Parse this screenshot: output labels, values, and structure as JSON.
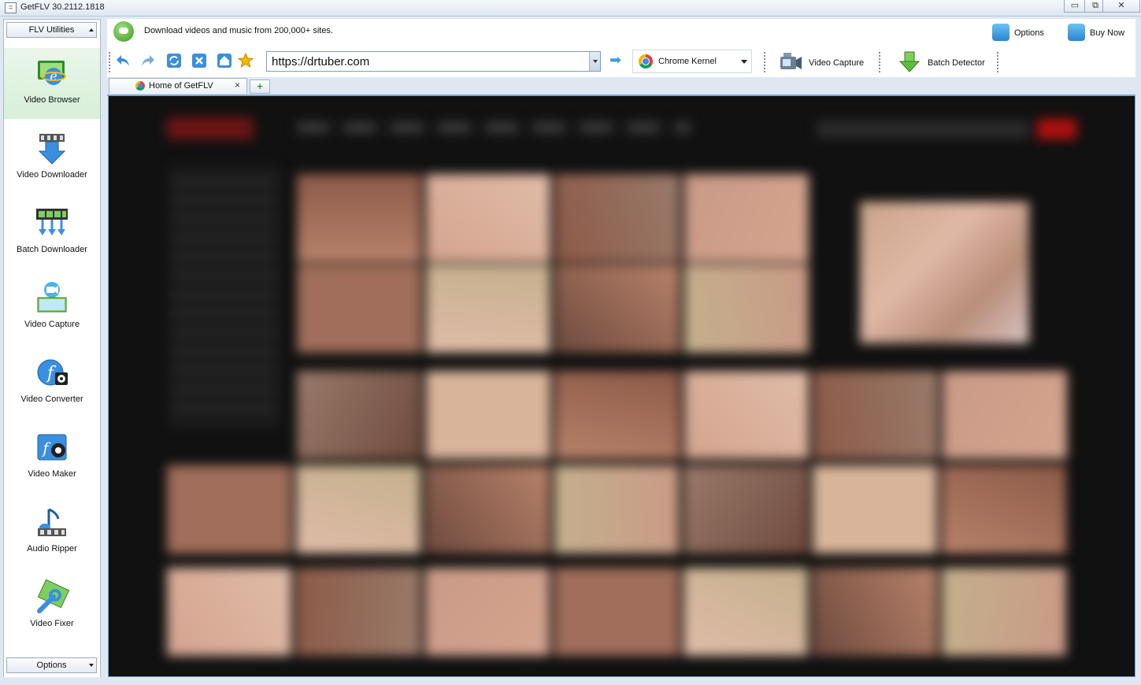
{
  "window": {
    "title": "GetFLV 30.2112.1818",
    "sys_menu": "=",
    "minimize": "▭",
    "maximize": "⧉",
    "close": "✕"
  },
  "sidebar": {
    "top_dropdown": "FLV Utilities",
    "bottom_dropdown": "Options",
    "items": [
      {
        "label": "Video Browser",
        "icon": "video-browser-icon",
        "active": true
      },
      {
        "label": "Video Downloader",
        "icon": "video-downloader-icon"
      },
      {
        "label": "Batch Downloader",
        "icon": "batch-downloader-icon"
      },
      {
        "label": "Video Capture",
        "icon": "video-capture-icon"
      },
      {
        "label": "Video Converter",
        "icon": "video-converter-icon"
      },
      {
        "label": "Video Maker",
        "icon": "video-maker-icon"
      },
      {
        "label": "Audio Ripper",
        "icon": "audio-ripper-icon"
      },
      {
        "label": "Video Fixer",
        "icon": "video-fixer-icon"
      }
    ]
  },
  "topbar": {
    "info": "Download videos and music from 200,000+ sites.",
    "options_label": "Options",
    "buy_label": "Buy Now"
  },
  "navbar": {
    "url": "https://drtuber.com",
    "kernel": "Chrome Kernel",
    "video_capture_label": "Video Capture",
    "batch_detector_label": "Batch Detector",
    "go_arrow": "➡"
  },
  "tabs": [
    {
      "title": "Home of GetFLV",
      "close": "×"
    }
  ],
  "new_tab": "+",
  "colors": {
    "accent": "#2a84cf",
    "active_tool_bg": "#d8efd8",
    "frame": "#dfe8f2"
  }
}
